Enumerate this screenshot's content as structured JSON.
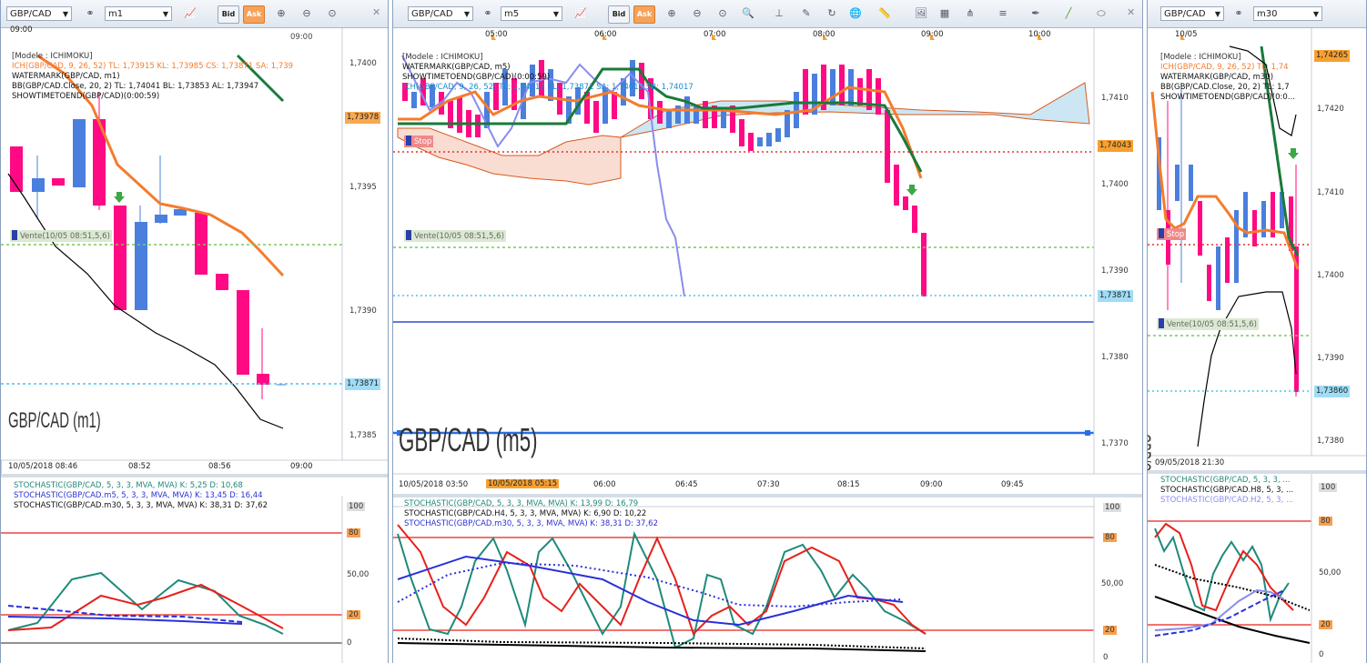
{
  "windows": [
    {
      "id": "left",
      "symbol": "GBP/CAD",
      "timeframe": "m1",
      "bid_label": "Bid",
      "ask_label": "Ask",
      "top_time_label": "09:00",
      "info_lines": [
        "[Modele : ICHIMOKU]",
        "ICH(GBP/CAD, 9, 26, 52)  TL: 1,73915   KL: 1,73985   CS: 1,73871   SA: 1,739",
        "WATERMARK(GBP/CAD, m1)",
        "BB(GBP/CAD.Close, 20, 2)  TL: 1,74041   BL: 1,73853   AL: 1,73947",
        "SHOWTIMETOEND(GBP/CAD)(0:00:59)"
      ],
      "price_ticks": [
        "1,7400",
        "1,7395",
        "1,7390",
        "1,7385"
      ],
      "price_tags": {
        "orange": "1,73978",
        "blue": "1,73871"
      },
      "vente_label": "Vente(10/05 08:51,5,6)",
      "watermark": "GBP/CAD (m1)",
      "time_ticks": [
        "10/05/2018 08:46",
        "08:52",
        "08:56",
        "09:00"
      ],
      "stoch_lines": [
        "STOCHASTIC(GBP/CAD, 5, 3, 3, MVA, MVA)   K: 5,25   D: 10,68",
        "STOCHASTIC(GBP/CAD.m5, 5, 3, 3, MVA, MVA)   K: 13,45   D: 16,44",
        "STOCHASTIC(GBP/CAD.m30, 5, 3, 3, MVA, MVA)   K: 38,31   D: 37,62"
      ],
      "stoch_ticks": [
        "100",
        "80",
        "50,00",
        "20",
        "0"
      ]
    },
    {
      "id": "middle",
      "symbol": "GBP/CAD",
      "timeframe": "m5",
      "bid_label": "Bid",
      "ask_label": "Ask",
      "top_time_labels": [
        "05:00",
        "06:00",
        "07:00",
        "08:00",
        "09:00",
        "10:00"
      ],
      "info_lines": [
        "[Modele : ICHIMOKU]",
        "WATERMARK(GBP/CAD, m5)",
        "SHOWTIMETOEND(GBP/CAD)(0:00:59)",
        "ICH(GBP/CAD, 9, 26, 52)  TL: 1,74017   KL: 1,73871   SA: 1,74012   SB: 1,74017"
      ],
      "stop_label": "Stop",
      "price_ticks": [
        "1,7410",
        "1,7400",
        "1,7390",
        "1,7380",
        "1,7370"
      ],
      "price_tags": {
        "orange": "1,74043",
        "blue": "1,73871"
      },
      "vente_label": "Vente(10/05 08:51,5,6)",
      "watermark": "GBP/CAD (m5)",
      "time_ticks": [
        "10/05/2018 03:50",
        "10/05/2018 05:15",
        "06:00",
        "06:45",
        "07:30",
        "08:15",
        "09:00",
        "09:45"
      ],
      "stoch_lines": [
        "STOCHASTIC(GBP/CAD, 5, 3, 3, MVA, MVA)   K: 13,99   D: 16,79",
        "STOCHASTIC(GBP/CAD.H4, 5, 3, 3, MVA, MVA)   K: 6,90   D: 10,22",
        "STOCHASTIC(GBP/CAD.m30, 5, 3, 3, MVA, MVA)   K: 38,31   D: 37,62"
      ],
      "stoch_ticks": [
        "100",
        "80",
        "50,00",
        "20",
        "0"
      ]
    },
    {
      "id": "right",
      "symbol": "GBP/CAD",
      "timeframe": "m30",
      "top_time_label": "10/05",
      "info_lines": [
        "[Modele : ICHIMOKU]",
        "ICH(GBP/CAD, 9, 26, 52)  TL: 1,74",
        "WATERMARK(GBP/CAD, m30)",
        "BB(GBP/CAD.Close, 20, 2)  TL: 1,7",
        "SHOWTIMETOEND(GBP/CAD)(0:0..."
      ],
      "stop_label": "Stop",
      "price_ticks": [
        "1,7420",
        "1,7410",
        "1,7400",
        "1,7390",
        "1,7380"
      ],
      "price_tags": {
        "orange": "1,74265",
        "blue": "1,73860"
      },
      "vente_label": "Vente(10/05 08:51,5,6)",
      "watermark": "GBP/CAD (m30)",
      "time_ticks": [
        "09/05/2018 21:30"
      ],
      "stoch_lines": [
        "STOCHASTIC(GBP/CAD, 5, 3, 3, ...",
        "STOCHASTIC(GBP/CAD.H8, 5, 3, ...",
        "STOCHASTIC(GBP/CAD.H2, 5, 3, ..."
      ],
      "stoch_ticks": [
        "100",
        "80",
        "50,00",
        "20",
        "0"
      ]
    }
  ],
  "colors": {
    "bear": "#ff0a84",
    "bull": "#4a7fde",
    "orange": "#f47c2c",
    "green": "#1a7a3a",
    "blue_line": "#2a4fd8",
    "dotted_green": "#7cc85a",
    "dotted_cyan": "#4fc3f0",
    "stop_red": "#e53030",
    "stoch_teal": "#1f8a7a",
    "stoch_red": "#e8201c",
    "stoch_blue": "#2a31d8"
  }
}
